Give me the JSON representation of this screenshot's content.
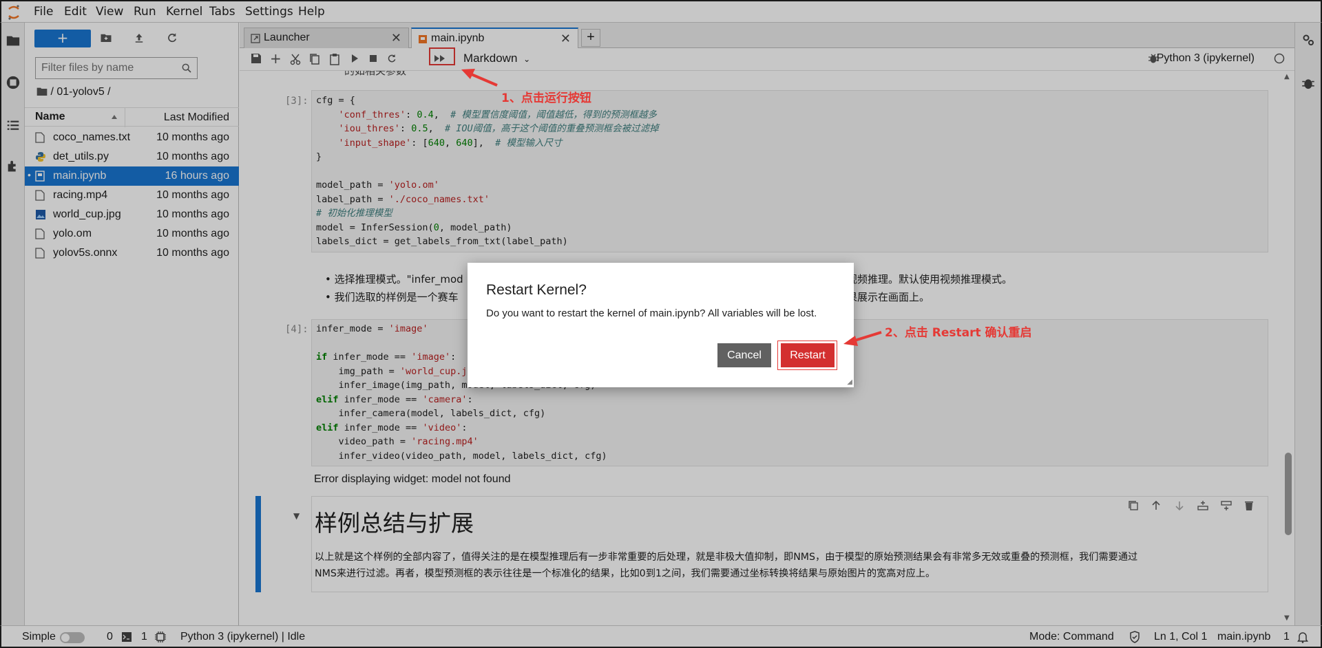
{
  "menubar": {
    "items": [
      "File",
      "Edit",
      "View",
      "Run",
      "Kernel",
      "Tabs",
      "Settings",
      "Help"
    ]
  },
  "filebrowser": {
    "new_label": "+",
    "filter_placeholder": "Filter files by name",
    "breadcrumb": "/ 01-yolov5 /",
    "col_name": "Name",
    "col_modified": "Last Modified",
    "files": [
      {
        "name": "coco_names.txt",
        "modified": "10 months ago",
        "icon": "file-icon"
      },
      {
        "name": "det_utils.py",
        "modified": "10 months ago",
        "icon": "python-icon"
      },
      {
        "name": "main.ipynb",
        "modified": "16 hours ago",
        "icon": "notebook-icon",
        "selected": true
      },
      {
        "name": "racing.mp4",
        "modified": "10 months ago",
        "icon": "file-icon"
      },
      {
        "name": "world_cup.jpg",
        "modified": "10 months ago",
        "icon": "image-icon"
      },
      {
        "name": "yolo.om",
        "modified": "10 months ago",
        "icon": "file-icon"
      },
      {
        "name": "yolov5s.onnx",
        "modified": "10 months ago",
        "icon": "file-icon"
      }
    ]
  },
  "tabs": [
    {
      "label": "Launcher"
    },
    {
      "label": "main.ipynb"
    }
  ],
  "toolbar": {
    "cell_type": "Markdown",
    "kernel": "Python 3 (ipykernel)"
  },
  "notebook": {
    "top_fragment": "的如相关参数",
    "cell3_prompt": "[3]:",
    "cell4_prompt": "[4]:",
    "bullet1": "选择推理模式。\"infer_mod",
    "bullet1_end": "视频推理。默认使用视频推理模式。",
    "bullet2": "我们选取的样例是一个赛车",
    "bullet2_end": "果展示在画面上。",
    "widget_error": "Error displaying widget: model not found",
    "heading": "样例总结与扩展",
    "paragraph1": "以上就是这个样例的全部内容了，值得关注的是在模型推理后有一步非常重要的后处理，就是非极大值抑制，即NMS，由于模型的原始预测结果会有非常多无效或重叠的预测框，我们需要通过",
    "paragraph2": "NMS来进行过滤。再者，模型预测框的表示往往是一个标准化的结果，比如0到1之间，我们需要通过坐标转换将结果与原始图片的宽高对应上。"
  },
  "statusbar": {
    "mode": "Simple",
    "count1": "0",
    "count2": "1",
    "kernel_status": "Python 3 (ipykernel) | Idle",
    "command_mode": "Mode: Command",
    "cursor": "Ln 1, Col 1",
    "filename": "main.ipynb",
    "notifications": "1"
  },
  "dialog": {
    "title": "Restart Kernel?",
    "body": "Do you want to restart the kernel of main.ipynb? All variables will be lost.",
    "cancel": "Cancel",
    "restart": "Restart"
  },
  "annotations": {
    "step1": "1、点击运行按钮",
    "step2": "2、点击 Restart 确认重启"
  },
  "colors": {
    "brand": "#1976d2",
    "danger": "#d32f2f",
    "annotation": "#e53935"
  }
}
